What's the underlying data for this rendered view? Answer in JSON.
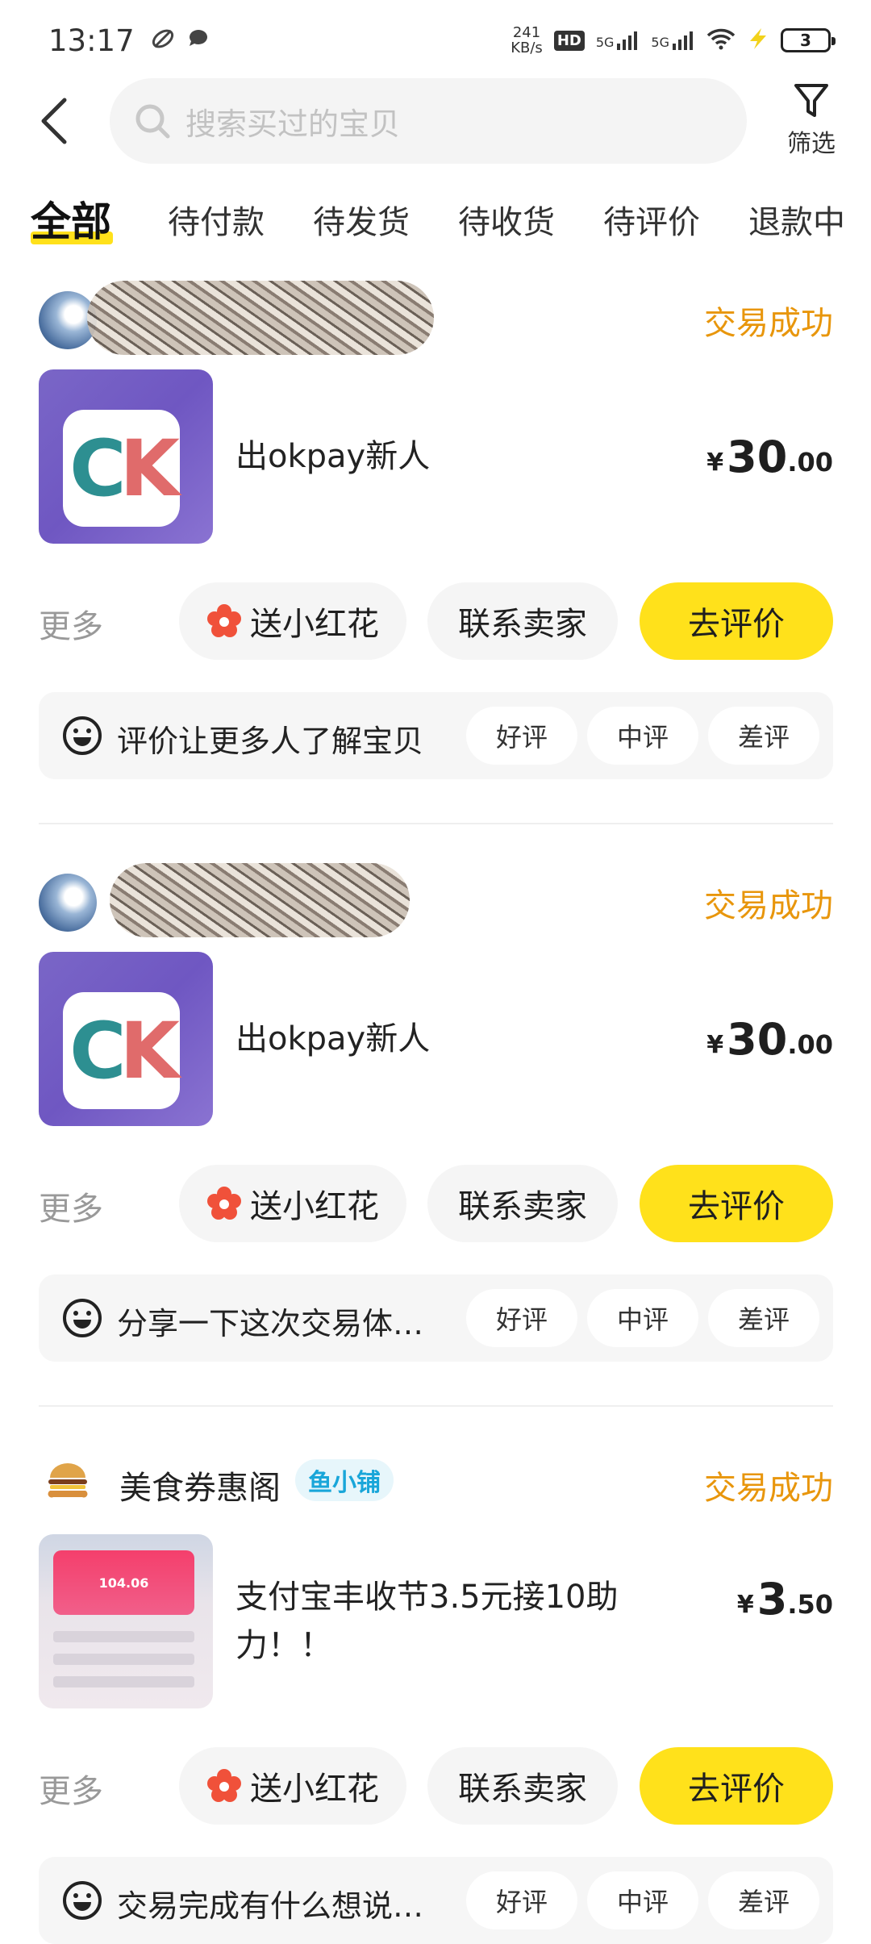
{
  "status_bar": {
    "time": "13:17",
    "net_speed_value": "241",
    "net_speed_unit": "KB/s",
    "hd_label": "HD",
    "signal1_label": "5G",
    "signal2_label": "5G",
    "battery": "3"
  },
  "search": {
    "placeholder": "搜索买过的宝贝",
    "filter_label": "筛选"
  },
  "tabs": [
    {
      "label": "全部",
      "active": true
    },
    {
      "label": "待付款"
    },
    {
      "label": "待发货"
    },
    {
      "label": "待收货"
    },
    {
      "label": "待评价"
    },
    {
      "label": "退款中"
    }
  ],
  "orders": [
    {
      "shop_name": "",
      "status": "交易成功",
      "title": "出okpay新人",
      "thumb_text": "CK",
      "price_symbol": "¥",
      "price_int": "30",
      "price_dec": ".00",
      "more": "更多",
      "flower_label": "送小红花",
      "contact_label": "联系卖家",
      "review_label": "去评价",
      "rating_prompt": "评价让更多人了解宝贝",
      "rate_good": "好评",
      "rate_mid": "中评",
      "rate_bad": "差评"
    },
    {
      "shop_name": "",
      "status": "交易成功",
      "title": "出okpay新人",
      "thumb_text": "CK",
      "price_symbol": "¥",
      "price_int": "30",
      "price_dec": ".00",
      "more": "更多",
      "flower_label": "送小红花",
      "contact_label": "联系卖家",
      "review_label": "去评价",
      "rating_prompt": "分享一下这次交易体…",
      "rate_good": "好评",
      "rate_mid": "中评",
      "rate_bad": "差评"
    },
    {
      "shop_name": "美食券惠阁",
      "shop_badge": "鱼小铺",
      "status": "交易成功",
      "title": "支付宝丰收节3.5元接10助力！！",
      "thumb_text": "104.06",
      "price_symbol": "¥",
      "price_int": "3",
      "price_dec": ".50",
      "more": "更多",
      "flower_label": "送小红花",
      "contact_label": "联系卖家",
      "review_label": "去评价",
      "rating_prompt": "交易完成有什么想说…",
      "rate_good": "好评",
      "rate_mid": "中评",
      "rate_bad": "差评"
    }
  ],
  "colors": {
    "accent_yellow": "#ffe11b",
    "status_orange": "#e8960c",
    "badge_blue": "#19a6d9"
  }
}
